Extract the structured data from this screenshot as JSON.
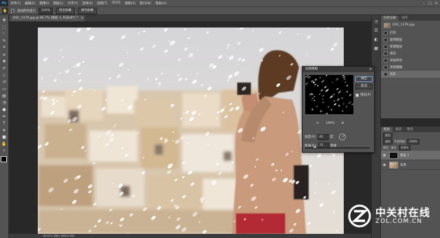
{
  "app": {
    "logo": "Ps"
  },
  "menu": [
    "文件(F)",
    "编辑(E)",
    "图像(I)",
    "图层(L)",
    "文字(Y)",
    "选择(S)",
    "滤镜(T)",
    "3D(D)",
    "视图(V)",
    "窗口(W)",
    "帮助(H)"
  ],
  "window_controls": {
    "minimize": "–",
    "maximize": "□",
    "close": "×"
  },
  "options_bar": {
    "tool_icon": "hand-icon",
    "checkbox_label": "滚动所有窗口",
    "zoom_value": "100%",
    "fit_screen_label": "适合屏幕",
    "fill_screen_label": "填充屏幕"
  },
  "document": {
    "tab_title": "DSC_1179.jpg @ 66.7% (图层 1, RGB/8*) *",
    "close": "×",
    "status": "66.67%   文档:1.68M/3.36M"
  },
  "tools": [
    "move-icon",
    "marquee-icon",
    "lasso-icon",
    "quick-select-icon",
    "crop-icon",
    "eyedropper-icon",
    "healing-icon",
    "brush-icon",
    "stamp-icon",
    "history-brush-icon",
    "eraser-icon",
    "gradient-icon",
    "blur-icon",
    "dodge-icon",
    "pen-icon",
    "type-icon",
    "path-select-icon",
    "shape-icon",
    "hand-icon",
    "zoom-icon"
  ],
  "history_panel": {
    "tabs": [
      "历史记录",
      "动作"
    ],
    "snapshot": "DSC_1179.jpg",
    "items": [
      "打开",
      "复制图层",
      "新建图层",
      "填充",
      "添加杂色",
      "高斯模糊",
      "色阶"
    ],
    "active_index": 6
  },
  "layers_panel": {
    "tabs": [
      "图层",
      "通道",
      "路径"
    ],
    "kind_label": "类型",
    "blend_mode": "滤色",
    "opacity_label": "不透明度:",
    "opacity": "100%",
    "lock_label": "锁定:",
    "fill_label": "填充:",
    "fill": "100%",
    "layers": [
      {
        "name": "图层 1",
        "active": true
      },
      {
        "name": "背景",
        "active": false
      }
    ]
  },
  "dialog": {
    "title": "动感模糊",
    "close": "×",
    "ok": "确定",
    "cancel": "取消",
    "preview_label": "预览(P)",
    "zoom_out": "⊖",
    "zoom_value": "100%",
    "zoom_in": "⊕",
    "angle_label": "角度(A):",
    "angle_value": "40",
    "angle_unit": "度",
    "distance_label": "距离(D):",
    "distance_value": "15",
    "distance_unit": "像素",
    "distance_level": 0.15
  },
  "watermark": {
    "cn": "中关村在线",
    "en": "ZOL.COM.CN"
  },
  "colors": {
    "panel": "#535353",
    "dark": "#282828",
    "accent": "#31a8ff"
  }
}
